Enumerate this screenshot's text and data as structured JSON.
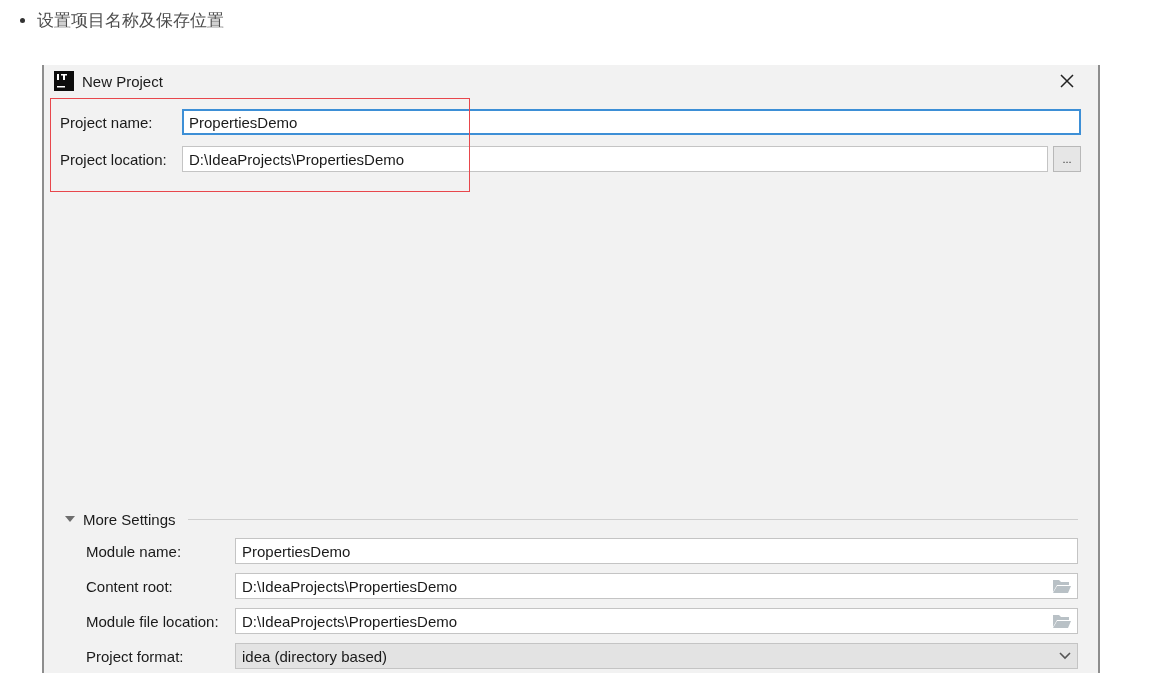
{
  "bullet": "设置项目名称及保存位置",
  "dialog": {
    "title": "New Project",
    "fields": [
      {
        "label": "Project name:",
        "value": "PropertiesDemo",
        "kind": "text",
        "focused": true
      },
      {
        "label": "Project location:",
        "value": "D:\\IdeaProjects\\PropertiesDemo",
        "kind": "browse",
        "focused": false,
        "button": "..."
      }
    ],
    "more_settings": {
      "label": "More Settings",
      "expanded": true,
      "fields": [
        {
          "label": "Module name:",
          "value": "PropertiesDemo",
          "kind": "text"
        },
        {
          "label": "Content root:",
          "value": "D:\\IdeaProjects\\PropertiesDemo",
          "kind": "folder"
        },
        {
          "label": "Module file location:",
          "value": "D:\\IdeaProjects\\PropertiesDemo",
          "kind": "folder"
        },
        {
          "label": "Project format:",
          "value": "idea (directory based)",
          "kind": "combo"
        }
      ]
    }
  }
}
